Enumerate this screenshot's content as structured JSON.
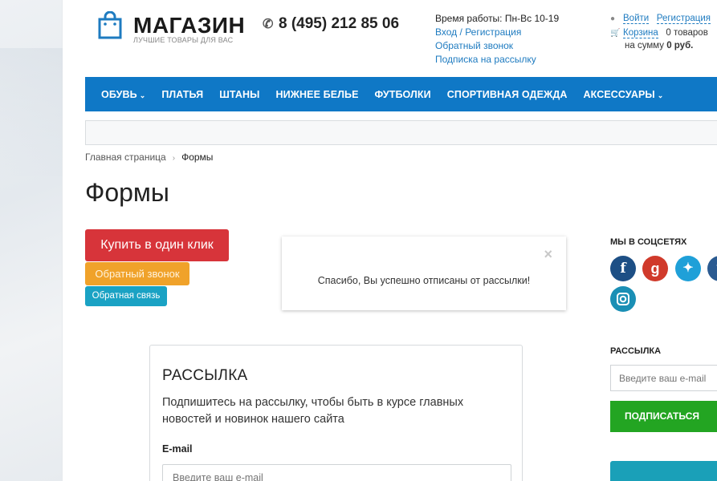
{
  "header": {
    "logo_title": "МАГАЗИН",
    "logo_subtitle": "ЛУЧШИЕ ТОВАРЫ ДЛЯ ВАС",
    "phone": "8 (495) 212 85 06",
    "hours": "Время работы: Пн-Вс 10-19",
    "login": "Вход",
    "login_sep": "/",
    "register": "Регистрация",
    "callback": "Обратный звонок",
    "newsletter_sub": "Подписка на рассылку",
    "account_login": "Войти",
    "account_register": "Регистрация",
    "cart_label": "Корзина",
    "cart_count": "0 товаров",
    "cart_sum_prefix": "на сумму",
    "cart_sum": "0 руб."
  },
  "nav": {
    "items": [
      {
        "label": "Обувь",
        "dropdown": true
      },
      {
        "label": "Платья",
        "dropdown": false
      },
      {
        "label": "Штаны",
        "dropdown": false
      },
      {
        "label": "Нижнее белье",
        "dropdown": false
      },
      {
        "label": "Футболки",
        "dropdown": false
      },
      {
        "label": "Спортивная одежда",
        "dropdown": false
      },
      {
        "label": "Аксессуары",
        "dropdown": true
      }
    ]
  },
  "breadcrumb": {
    "home": "Главная страница",
    "current": "Формы"
  },
  "page": {
    "title": "Формы",
    "buy_one_click": "Купить в один клик",
    "callback_button": "Обратный звонок",
    "feedback_button": "Обратная связь"
  },
  "subscribe": {
    "title": "Рассылка",
    "text": "Подпишитесь на рассылку, чтобы быть в курсе главных новостей и новинок нашего сайта",
    "email_label": "E-mail",
    "email_placeholder": "Введите ваш e-mail"
  },
  "sidebar": {
    "social_heading": "МЫ В СОЦСЕТЯХ",
    "newsletter_heading": "РАССЫЛКА",
    "email_placeholder": "Введите ваш e-mail",
    "subscribe_button": "ПОДПИСАТЬСЯ"
  },
  "modal": {
    "message": "Спасибо, Вы успешно отписаны от рассылки!",
    "close": "×"
  },
  "colors": {
    "nav": "#0f78c6",
    "red_button": "#d7343a",
    "orange_button": "#f0a22a",
    "cyan_button": "#1aa2c4",
    "green_button": "#23a522",
    "link": "#1e7bc0"
  }
}
